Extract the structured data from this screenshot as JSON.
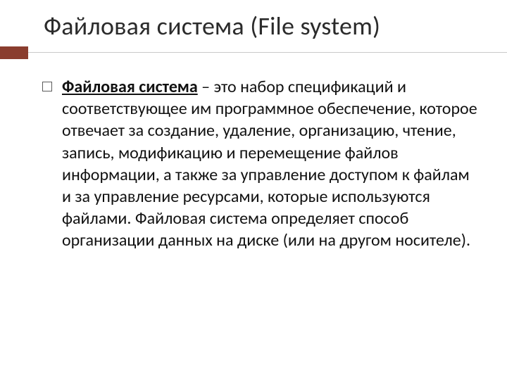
{
  "slide": {
    "title": "Файловая система (File system)",
    "bullet": {
      "term": "Файловая система",
      "rest": " – это набор спецификаций и соответствующее им программное обеспечение, которое отвечает за создание, удаление, организацию, чтение, запись, модификацию и перемещение файлов информации, а также за управление доступом к файлам и за управление ресурсами, которые используются файлами. Файловая система определяет способ организации данных на диске (или на другом носителе)."
    }
  },
  "colors": {
    "accent": "#8a3d2e"
  }
}
